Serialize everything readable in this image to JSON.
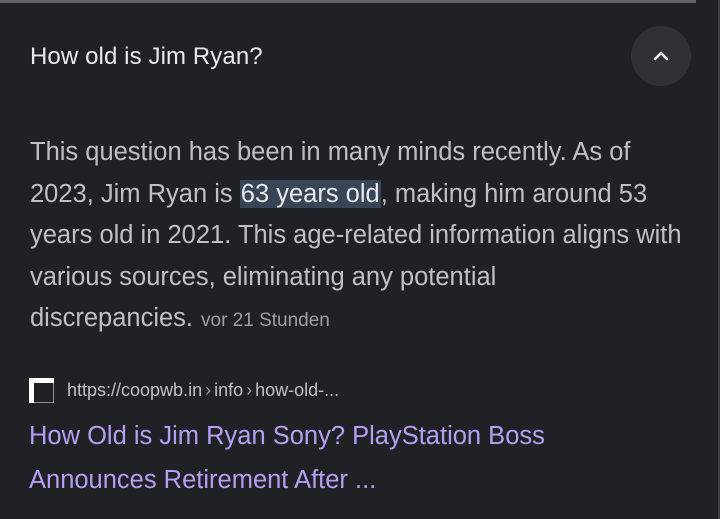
{
  "question": {
    "title": "How old is Jim Ryan?",
    "expanded": true,
    "toggle_icon": "chevron-up-icon"
  },
  "answer": {
    "text_before": "This question has been in many minds recently. As of 2023, Jim Ryan is ",
    "highlight": "63 years old",
    "text_after": ", making him around 53 years old in 2021. This age-related information aligns with various sources, eliminating any potential discrepancies.",
    "timestamp": "vor 21 Stunden"
  },
  "source": {
    "favicon": "site-favicon-icon",
    "domain": "https://coopwb.in",
    "path_1": "info",
    "path_2": "how-old-..."
  },
  "result": {
    "title": "How Old is Jim Ryan Sony? PlayStation Boss Announces Retirement After ..."
  },
  "colors": {
    "background": "#202124",
    "link": "#b59ff5",
    "highlight": "#394457"
  }
}
